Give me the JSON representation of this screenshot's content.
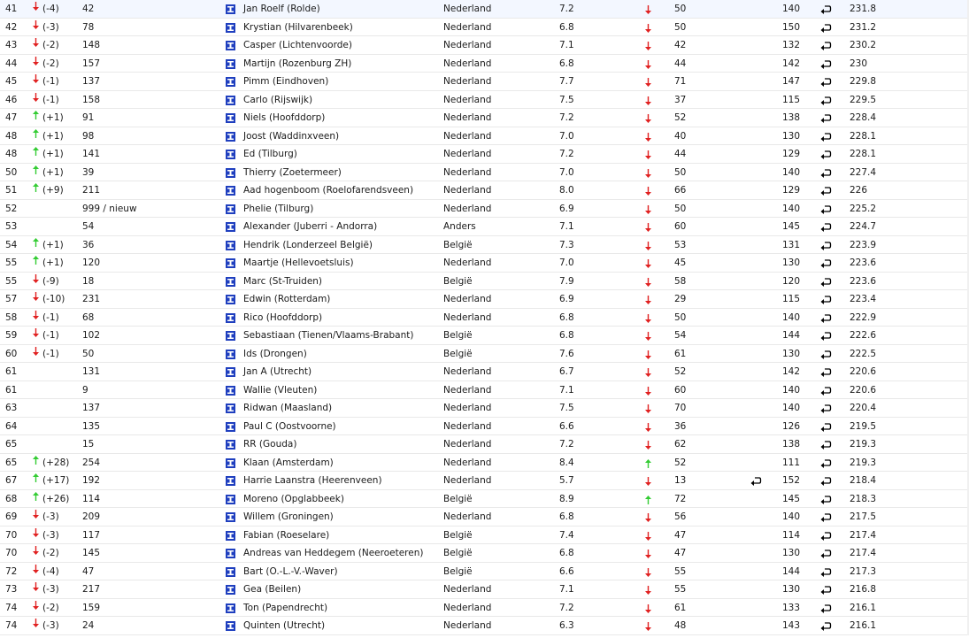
{
  "rows": [
    {
      "pos": "41",
      "dir": "down",
      "delta": "(-4)",
      "prev": "42",
      "name": "Jan Roelf (Rolde)",
      "country": "Nederland",
      "score": "7.2",
      "dir2": "down",
      "val": "50",
      "retour2": false,
      "cnt": "140",
      "total": "231.8"
    },
    {
      "pos": "42",
      "dir": "down",
      "delta": "(-3)",
      "prev": "78",
      "name": "Krystian (Hilvarenbeek)",
      "country": "Nederland",
      "score": "6.8",
      "dir2": "down",
      "val": "50",
      "retour2": false,
      "cnt": "150",
      "total": "231.2"
    },
    {
      "pos": "43",
      "dir": "down",
      "delta": "(-2)",
      "prev": "148",
      "name": "Casper (Lichtenvoorde)",
      "country": "Nederland",
      "score": "7.1",
      "dir2": "down",
      "val": "42",
      "retour2": false,
      "cnt": "132",
      "total": "230.2"
    },
    {
      "pos": "44",
      "dir": "down",
      "delta": "(-2)",
      "prev": "157",
      "name": "Martijn (Rozenburg ZH)",
      "country": "Nederland",
      "score": "6.8",
      "dir2": "down",
      "val": "44",
      "retour2": false,
      "cnt": "142",
      "total": "230"
    },
    {
      "pos": "45",
      "dir": "down",
      "delta": "(-1)",
      "prev": "137",
      "name": "Pimm (Eindhoven)",
      "country": "Nederland",
      "score": "7.7",
      "dir2": "down",
      "val": "71",
      "retour2": false,
      "cnt": "147",
      "total": "229.8"
    },
    {
      "pos": "46",
      "dir": "down",
      "delta": "(-1)",
      "prev": "158",
      "name": "Carlo (Rijswijk)",
      "country": "Nederland",
      "score": "7.5",
      "dir2": "down",
      "val": "37",
      "retour2": false,
      "cnt": "115",
      "total": "229.5"
    },
    {
      "pos": "47",
      "dir": "up",
      "delta": "(+1)",
      "prev": "91",
      "name": "Niels (Hoofddorp)",
      "country": "Nederland",
      "score": "7.2",
      "dir2": "down",
      "val": "52",
      "retour2": false,
      "cnt": "138",
      "total": "228.4"
    },
    {
      "pos": "48",
      "dir": "up",
      "delta": "(+1)",
      "prev": "98",
      "name": "Joost (Waddinxveen)",
      "country": "Nederland",
      "score": "7.0",
      "dir2": "down",
      "val": "40",
      "retour2": false,
      "cnt": "130",
      "total": "228.1"
    },
    {
      "pos": "48",
      "dir": "up",
      "delta": "(+1)",
      "prev": "141",
      "name": "Ed (Tilburg)",
      "country": "Nederland",
      "score": "7.2",
      "dir2": "down",
      "val": "44",
      "retour2": false,
      "cnt": "129",
      "total": "228.1"
    },
    {
      "pos": "50",
      "dir": "up",
      "delta": "(+1)",
      "prev": "39",
      "name": "Thierry (Zoetermeer)",
      "country": "Nederland",
      "score": "7.0",
      "dir2": "down",
      "val": "50",
      "retour2": false,
      "cnt": "140",
      "total": "227.4"
    },
    {
      "pos": "51",
      "dir": "up",
      "delta": "(+9)",
      "prev": "211",
      "name": "Aad hogenboom (Roelofarendsveen)",
      "country": "Nederland",
      "score": "8.0",
      "dir2": "down",
      "val": "66",
      "retour2": false,
      "cnt": "129",
      "total": "226"
    },
    {
      "pos": "52",
      "dir": "",
      "delta": "",
      "prev": "999 / nieuw",
      "name": "Phelie (Tilburg)",
      "country": "Nederland",
      "score": "6.9",
      "dir2": "down",
      "val": "50",
      "retour2": false,
      "cnt": "140",
      "total": "225.2"
    },
    {
      "pos": "53",
      "dir": "",
      "delta": "",
      "prev": "54",
      "name": "Alexander (Juberri - Andorra)",
      "country": "Anders",
      "score": "7.1",
      "dir2": "down",
      "val": "60",
      "retour2": false,
      "cnt": "145",
      "total": "224.7"
    },
    {
      "pos": "54",
      "dir": "up",
      "delta": "(+1)",
      "prev": "36",
      "name": "Hendrik (Londerzeel België)",
      "country": "België",
      "score": "7.3",
      "dir2": "down",
      "val": "53",
      "retour2": false,
      "cnt": "131",
      "total": "223.9"
    },
    {
      "pos": "55",
      "dir": "up",
      "delta": "(+1)",
      "prev": "120",
      "name": "Maartje (Hellevoetsluis)",
      "country": "Nederland",
      "score": "7.0",
      "dir2": "down",
      "val": "45",
      "retour2": false,
      "cnt": "130",
      "total": "223.6"
    },
    {
      "pos": "55",
      "dir": "down",
      "delta": "(-9)",
      "prev": "18",
      "name": "Marc (St-Truiden)",
      "country": "België",
      "score": "7.9",
      "dir2": "down",
      "val": "58",
      "retour2": false,
      "cnt": "120",
      "total": "223.6"
    },
    {
      "pos": "57",
      "dir": "down",
      "delta": "(-10)",
      "prev": "231",
      "name": "Edwin (Rotterdam)",
      "country": "Nederland",
      "score": "6.9",
      "dir2": "down",
      "val": "29",
      "retour2": false,
      "cnt": "115",
      "total": "223.4"
    },
    {
      "pos": "58",
      "dir": "down",
      "delta": "(-1)",
      "prev": "68",
      "name": "Rico (Hoofddorp)",
      "country": "Nederland",
      "score": "6.8",
      "dir2": "down",
      "val": "50",
      "retour2": false,
      "cnt": "140",
      "total": "222.9"
    },
    {
      "pos": "59",
      "dir": "down",
      "delta": "(-1)",
      "prev": "102",
      "name": "Sebastiaan (Tienen/Vlaams-Brabant)",
      "country": "België",
      "score": "6.8",
      "dir2": "down",
      "val": "54",
      "retour2": false,
      "cnt": "144",
      "total": "222.6"
    },
    {
      "pos": "60",
      "dir": "down",
      "delta": "(-1)",
      "prev": "50",
      "name": "Ids (Drongen)",
      "country": "België",
      "score": "7.6",
      "dir2": "down",
      "val": "61",
      "retour2": false,
      "cnt": "130",
      "total": "222.5"
    },
    {
      "pos": "61",
      "dir": "",
      "delta": "",
      "prev": "131",
      "name": "Jan A (Utrecht)",
      "country": "Nederland",
      "score": "6.7",
      "dir2": "down",
      "val": "52",
      "retour2": false,
      "cnt": "142",
      "total": "220.6"
    },
    {
      "pos": "61",
      "dir": "",
      "delta": "",
      "prev": "9",
      "name": "Wallie (Vleuten)",
      "country": "Nederland",
      "score": "7.1",
      "dir2": "down",
      "val": "60",
      "retour2": false,
      "cnt": "140",
      "total": "220.6"
    },
    {
      "pos": "63",
      "dir": "",
      "delta": "",
      "prev": "137",
      "name": "Ridwan (Maasland)",
      "country": "Nederland",
      "score": "7.5",
      "dir2": "down",
      "val": "70",
      "retour2": false,
      "cnt": "140",
      "total": "220.4"
    },
    {
      "pos": "64",
      "dir": "",
      "delta": "",
      "prev": "135",
      "name": "Paul C (Oostvoorne)",
      "country": "Nederland",
      "score": "6.6",
      "dir2": "down",
      "val": "36",
      "retour2": false,
      "cnt": "126",
      "total": "219.5"
    },
    {
      "pos": "65",
      "dir": "",
      "delta": "",
      "prev": "15",
      "name": "RR (Gouda)",
      "country": "Nederland",
      "score": "7.2",
      "dir2": "down",
      "val": "62",
      "retour2": false,
      "cnt": "138",
      "total": "219.3"
    },
    {
      "pos": "65",
      "dir": "up",
      "delta": "(+28)",
      "prev": "254",
      "name": "Klaan (Amsterdam)",
      "country": "Nederland",
      "score": "8.4",
      "dir2": "up",
      "val": "52",
      "retour2": false,
      "cnt": "111",
      "total": "219.3"
    },
    {
      "pos": "67",
      "dir": "up",
      "delta": "(+17)",
      "prev": "192",
      "name": "Harrie Laanstra (Heerenveen)",
      "country": "Nederland",
      "score": "5.7",
      "dir2": "down",
      "val": "13",
      "retour2": true,
      "cnt": "152",
      "total": "218.4"
    },
    {
      "pos": "68",
      "dir": "up",
      "delta": "(+26)",
      "prev": "114",
      "name": "Moreno (Opglabbeek)",
      "country": "België",
      "score": "8.9",
      "dir2": "up",
      "val": "72",
      "retour2": false,
      "cnt": "145",
      "total": "218.3"
    },
    {
      "pos": "69",
      "dir": "down",
      "delta": "(-3)",
      "prev": "209",
      "name": "Willem (Groningen)",
      "country": "Nederland",
      "score": "6.8",
      "dir2": "down",
      "val": "56",
      "retour2": false,
      "cnt": "140",
      "total": "217.5"
    },
    {
      "pos": "70",
      "dir": "down",
      "delta": "(-3)",
      "prev": "117",
      "name": "Fabian (Roeselare)",
      "country": "België",
      "score": "7.4",
      "dir2": "down",
      "val": "47",
      "retour2": false,
      "cnt": "114",
      "total": "217.4"
    },
    {
      "pos": "70",
      "dir": "down",
      "delta": "(-2)",
      "prev": "145",
      "name": "Andreas van Heddegem (Neeroeteren)",
      "country": "België",
      "score": "6.8",
      "dir2": "down",
      "val": "47",
      "retour2": false,
      "cnt": "130",
      "total": "217.4"
    },
    {
      "pos": "72",
      "dir": "down",
      "delta": "(-4)",
      "prev": "47",
      "name": "Bart (O.-L.-V.-Waver)",
      "country": "België",
      "score": "6.6",
      "dir2": "down",
      "val": "55",
      "retour2": false,
      "cnt": "144",
      "total": "217.3"
    },
    {
      "pos": "73",
      "dir": "down",
      "delta": "(-3)",
      "prev": "217",
      "name": "Gea (Beilen)",
      "country": "Nederland",
      "score": "7.1",
      "dir2": "down",
      "val": "55",
      "retour2": false,
      "cnt": "130",
      "total": "216.8"
    },
    {
      "pos": "74",
      "dir": "down",
      "delta": "(-2)",
      "prev": "159",
      "name": "Ton (Papendrecht)",
      "country": "Nederland",
      "score": "7.2",
      "dir2": "down",
      "val": "61",
      "retour2": false,
      "cnt": "133",
      "total": "216.1"
    },
    {
      "pos": "74",
      "dir": "down",
      "delta": "(-3)",
      "prev": "24",
      "name": "Quinten (Utrecht)",
      "country": "Nederland",
      "score": "6.3",
      "dir2": "down",
      "val": "48",
      "retour2": false,
      "cnt": "143",
      "total": "216.1"
    }
  ],
  "icons": {
    "row_icon": "profile-box-icon",
    "retour_icon": "return-arrow-icon",
    "up_icon": "arrow-up-icon",
    "down_icon": "arrow-down-icon"
  },
  "colors": {
    "up": "#33cc33",
    "down": "#e02020",
    "profile_icon": "#1f3fbf"
  }
}
